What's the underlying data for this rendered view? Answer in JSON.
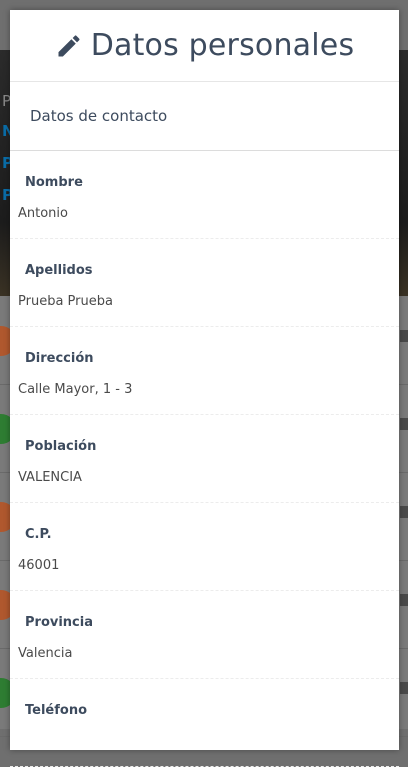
{
  "modal": {
    "title": "Datos personales",
    "title_icon": "pencil-icon",
    "section_title": "Datos de contacto",
    "fields": [
      {
        "label": "Nombre",
        "value": "Antonio"
      },
      {
        "label": "Apellidos",
        "value": "Prueba Prueba"
      },
      {
        "label": "Dirección",
        "value": "Calle Mayor, 1 - 3"
      },
      {
        "label": "Población",
        "value": "VALENCIA"
      },
      {
        "label": "C.P.",
        "value": "46001"
      },
      {
        "label": "Provincia",
        "value": "Valencia"
      },
      {
        "label": "Teléfono",
        "value": ""
      }
    ]
  },
  "colors": {
    "title_text": "#3d4b5e",
    "backdrop": "#6f6f6f",
    "background_link": "#0a6da8"
  }
}
